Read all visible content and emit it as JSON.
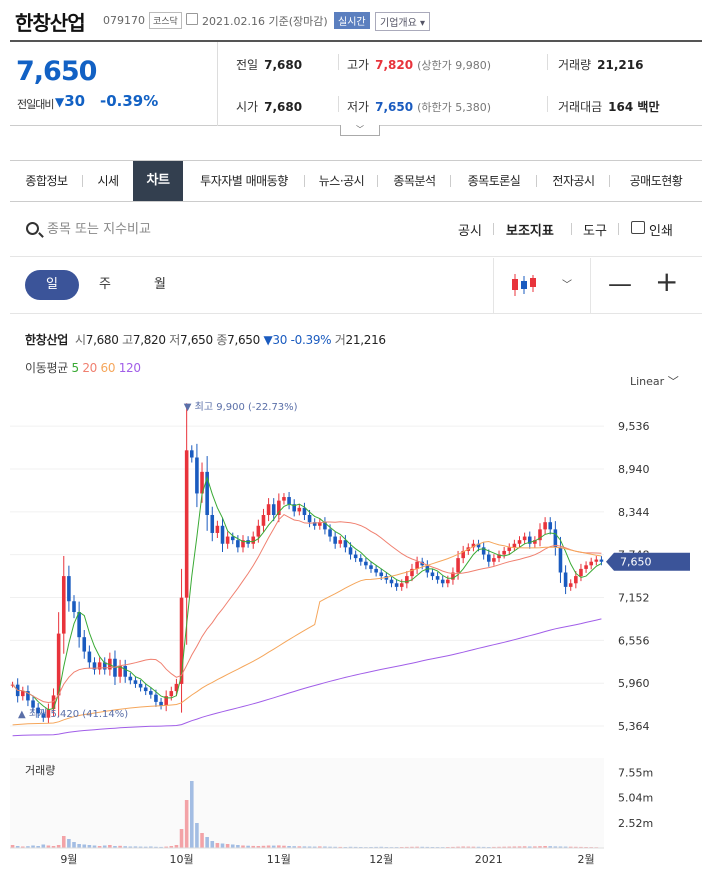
{
  "header": {
    "name": "한창산업",
    "code": "079170",
    "market": "코스닥",
    "date": "2021.02.16 기준(장마감)",
    "realtime": "실시간",
    "company_info": "기업개요"
  },
  "quote": {
    "price": "7,650",
    "change_label": "전일대비",
    "change": "30",
    "change_pct": "-0.39%",
    "prev_label": "전일",
    "prev": "7,680",
    "high_label": "고가",
    "high": "7,820",
    "upper_limit": "(상한가 9,980)",
    "volume_label": "거래량",
    "volume": "21,216",
    "open_label": "시가",
    "open": "7,680",
    "low_label": "저가",
    "low": "7,650",
    "lower_limit": "(하한가 5,380)",
    "amount_label": "거래대금",
    "amount": "164 백만"
  },
  "tabs": [
    "종합정보",
    "시세",
    "차트",
    "투자자별 매매동향",
    "뉴스·공시",
    "종목분석",
    "종목토론실",
    "전자공시",
    "공매도현황"
  ],
  "active_tab": "차트",
  "search": {
    "placeholder": "종목 또는 지수비교",
    "tool_disclosure": "공시",
    "tool_indicator": "보조지표",
    "tool_draw": "도구",
    "tool_print": "인쇄"
  },
  "periods": {
    "day": "일",
    "week": "주",
    "month": "월"
  },
  "summary": {
    "name": "한창산업",
    "open_k": "시",
    "open": "7,680",
    "high_k": "고",
    "high": "7,820",
    "low_k": "저",
    "low": "7,650",
    "close_k": "종",
    "close": "7,650",
    "change": "▼30",
    "pct": "-0.39%",
    "vol_k": "거",
    "vol": "21,216"
  },
  "ma_legend": {
    "label": "이동평균",
    "ma5": "5",
    "ma20": "20",
    "ma60": "60",
    "ma120": "120"
  },
  "scale_mode": "Linear",
  "colors": {
    "up": "#e8333b",
    "down": "#1a5bbf",
    "ma5": "#3aaa35",
    "ma20": "#f08070",
    "ma60": "#f5a65b",
    "ma120": "#a15ee8",
    "accent": "#3b5499"
  },
  "chart_data": {
    "type": "candlestick",
    "ylim": [
      5100,
      9900
    ],
    "y_ticks": [
      "9,536",
      "8,940",
      "8,344",
      "7,748",
      "7,152",
      "6,556",
      "5,960",
      "5,364"
    ],
    "y_tick_values": [
      9536,
      8940,
      8344,
      7748,
      7152,
      6556,
      5960,
      5364
    ],
    "x_labels": [
      "9월",
      "10월",
      "11월",
      "12월",
      "2021",
      "2월"
    ],
    "x_label_index": [
      11,
      33,
      52,
      72,
      93,
      112
    ],
    "last_price": "7,650",
    "max_label": "▼ 최고 9,900 (-22.73%)",
    "max_index": 35,
    "min_label": "▲ 최저 5,420 (41.14%)",
    "min_index": 6,
    "volume_label": "거래량",
    "volume_ticks": [
      "7.55m",
      "5.04m",
      "2.52m"
    ],
    "volume_tick_values": [
      7550000,
      5040000,
      2520000
    ],
    "closes": [
      5940,
      5780,
      5850,
      5720,
      5620,
      5540,
      5480,
      5600,
      5790,
      6650,
      7450,
      7100,
      6950,
      6600,
      6400,
      6250,
      6150,
      6250,
      6150,
      6300,
      6050,
      6200,
      6050,
      6000,
      5950,
      5900,
      5850,
      5800,
      5700,
      5650,
      5780,
      5850,
      5950,
      7150,
      9200,
      9100,
      8600,
      8900,
      8300,
      8050,
      8150,
      7900,
      8000,
      7950,
      7850,
      7950,
      7900,
      8000,
      8150,
      8300,
      8450,
      8300,
      8500,
      8550,
      8450,
      8350,
      8400,
      8300,
      8200,
      8150,
      8200,
      8100,
      8000,
      7900,
      7950,
      7850,
      7750,
      7700,
      7650,
      7600,
      7550,
      7500,
      7450,
      7400,
      7350,
      7300,
      7350,
      7450,
      7550,
      7650,
      7600,
      7500,
      7450,
      7400,
      7350,
      7400,
      7500,
      7700,
      7800,
      7850,
      7900,
      7850,
      7750,
      7650,
      7700,
      7750,
      7800,
      7850,
      7900,
      7950,
      8000,
      7900,
      7950,
      8100,
      8200,
      8100,
      7850,
      7500,
      7300,
      7350,
      7450,
      7550,
      7600,
      7650,
      7680,
      7650
    ],
    "volumes": [
      300000,
      200000,
      150000,
      180000,
      250000,
      200000,
      350000,
      250000,
      200000,
      300000,
      1200000,
      900000,
      600000,
      400000,
      350000,
      300000,
      250000,
      200000,
      250000,
      300000,
      200000,
      220000,
      180000,
      150000,
      160000,
      140000,
      130000,
      150000,
      120000,
      110000,
      140000,
      200000,
      300000,
      1900000,
      4800000,
      6700000,
      2500000,
      1500000,
      1100000,
      700000,
      500000,
      450000,
      400000,
      350000,
      300000,
      250000,
      230000,
      210000,
      200000,
      220000,
      250000,
      240000,
      260000,
      230000,
      200000,
      180000,
      170000,
      160000,
      150000,
      140000,
      160000,
      150000,
      130000,
      120000,
      110000,
      100000,
      120000,
      110000,
      100000,
      90000,
      100000,
      110000,
      120000,
      100000,
      90000,
      95000,
      100000,
      110000,
      120000,
      130000,
      120000,
      110000,
      100000,
      95000,
      90000,
      100000,
      110000,
      130000,
      150000,
      140000,
      130000,
      120000,
      110000,
      100000,
      110000,
      120000,
      130000,
      140000,
      150000,
      160000,
      170000,
      150000,
      160000,
      180000,
      200000,
      180000,
      160000,
      150000,
      140000,
      130000,
      120000,
      110000,
      100000,
      90000,
      80000,
      21216
    ]
  }
}
